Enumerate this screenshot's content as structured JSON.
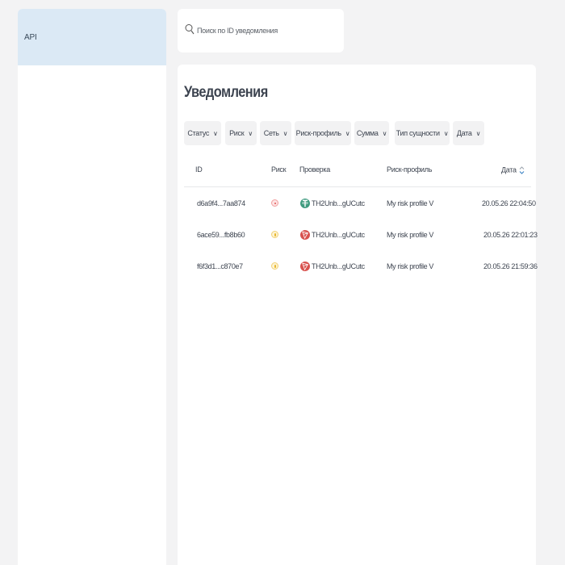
{
  "sidebar": {
    "items": [
      {
        "label": "API"
      }
    ]
  },
  "search": {
    "placeholder": "Поиск по ID уведомления",
    "value": ""
  },
  "main": {
    "title": "Уведомления",
    "filters": [
      "Статус",
      "Риск",
      "Сеть",
      "Риск-профиль",
      "Сумма",
      "Тип сущности",
      "Дата"
    ],
    "table": {
      "columns": [
        "ID",
        "Риск",
        "Проверка",
        "Риск-профиль",
        "Дата"
      ],
      "rows": [
        {
          "id": "d6a9f4...7aa874",
          "risk": "high",
          "check": "TH2Unb...gUCutc",
          "coin": "USDT",
          "profile": "My risk profile V",
          "date": "20.05.26 22:04:50"
        },
        {
          "id": "6ace59...fb8b60",
          "risk": "medium",
          "check": "TH2Unb...gUCutc",
          "coin": "TRX",
          "profile": "My risk profile V",
          "date": "20.05.26 22:01:23"
        },
        {
          "id": "f6f3d1...c870e7",
          "risk": "medium",
          "check": "TH2Unb...gUCutc",
          "coin": "TRX",
          "profile": "My risk profile V",
          "date": "20.05.26 21:59:36"
        }
      ]
    }
  },
  "icons": {
    "search": "search-icon",
    "chevron": "chevron-down-icon",
    "sort": "sort-icon",
    "usdt": "usdt-icon",
    "trx": "tron-icon"
  },
  "colors": {
    "sidebar_active": "#dbe9f5",
    "usdt": "#3f9b7f",
    "trx": "#d8524e",
    "risk_high": "#e05555",
    "risk_medium": "#e8b730",
    "sort_active": "#3b82c4"
  }
}
